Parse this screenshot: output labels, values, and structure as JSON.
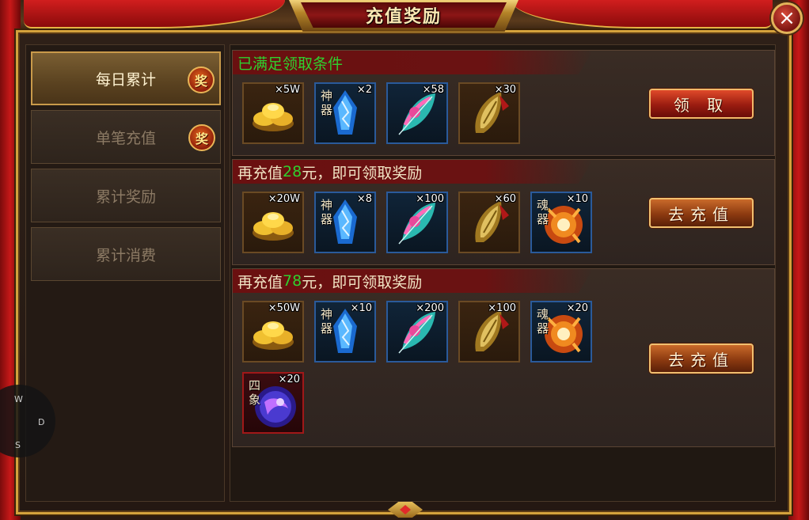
{
  "title": "充值奖励",
  "close_symbol": "×",
  "nav": [
    {
      "label": "每日累计",
      "badge": "奖",
      "active": true
    },
    {
      "label": "单笔充值",
      "badge": "奖",
      "active": false
    },
    {
      "label": "累计奖励",
      "badge": "",
      "active": false
    },
    {
      "label": "累计消费",
      "badge": "",
      "active": false
    }
  ],
  "sections": [
    {
      "status_text": "已满足领取条件",
      "button_label": "领 取",
      "items": [
        {
          "icon": "gold-ingot-icon",
          "qty": "×5W"
        },
        {
          "icon": "artifact-crystal-icon",
          "tag": "神器",
          "qty": "×2"
        },
        {
          "icon": "feather-icon",
          "qty": "×58"
        },
        {
          "icon": "gold-blade-icon",
          "qty": "×30"
        }
      ]
    },
    {
      "prefix": "再充值",
      "amount": "28",
      "suffix": "元，即可领取奖励",
      "button_label": "去充值",
      "items": [
        {
          "icon": "gold-ingot-icon",
          "qty": "×20W"
        },
        {
          "icon": "artifact-crystal-icon",
          "tag": "神器",
          "qty": "×8"
        },
        {
          "icon": "feather-icon",
          "qty": "×100"
        },
        {
          "icon": "gold-blade-icon",
          "qty": "×60"
        },
        {
          "icon": "soul-orb-icon",
          "tag": "魂器",
          "qty": "×10"
        }
      ]
    },
    {
      "prefix": "再充值",
      "amount": "78",
      "suffix": "元，即可领取奖励",
      "button_label": "去充值",
      "items": [
        {
          "icon": "gold-ingot-icon",
          "qty": "×50W"
        },
        {
          "icon": "artifact-crystal-icon",
          "tag": "神器",
          "qty": "×10"
        },
        {
          "icon": "feather-icon",
          "qty": "×200"
        },
        {
          "icon": "gold-blade-icon",
          "qty": "×100"
        },
        {
          "icon": "soul-orb-icon",
          "tag": "魂器",
          "qty": "×20"
        },
        {
          "icon": "four-symbols-orb-icon",
          "tag": "四象",
          "qty": "×20"
        }
      ]
    }
  ],
  "joystick": {
    "w": "W",
    "d": "D",
    "s": "S"
  },
  "colors": {
    "accent_green": "#2fd02f",
    "gold": "#d4a23c",
    "button_red": "#9a1c10"
  }
}
